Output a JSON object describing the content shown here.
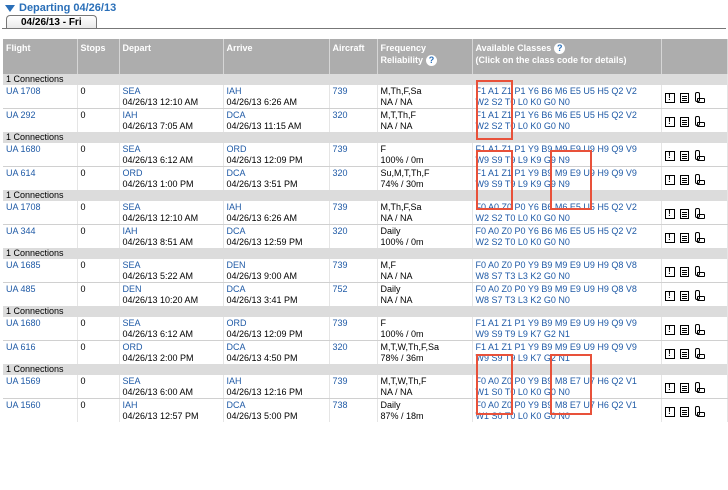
{
  "header": {
    "title": "Departing 04/26/13"
  },
  "tab": {
    "label": "04/26/13 - Fri"
  },
  "columns": {
    "flight": "Flight",
    "stops": "Stops",
    "depart": "Depart",
    "arrive": "Arrive",
    "aircraft": "Aircraft",
    "frequency_line1": "Frequency",
    "frequency_line2": "Reliability",
    "classes_line1": "Available Classes",
    "classes_line2": "(Click on the class code for details)"
  },
  "connection_label": "1 Connections",
  "groups": [
    {
      "legs": [
        {
          "flight": "UA 1708",
          "stops": "0",
          "dep_city": "SEA",
          "dep_time": "04/26/13 12:10 AM",
          "arr_city": "IAH",
          "arr_time": "04/26/13 6:26 AM",
          "aircraft": "739",
          "freq": "M,Th,F,Sa",
          "rel": "NA / NA",
          "cls1": "F1 A1 Z1 P1 Y6 B6 M6 E5 U5 H5 Q2 V2",
          "cls2": "W2 S2 T0 L0 K0 G0 N0"
        },
        {
          "flight": "UA 292",
          "stops": "0",
          "dep_city": "IAH",
          "dep_time": "04/26/13 7:05 AM",
          "arr_city": "DCA",
          "arr_time": "04/26/13 11:15 AM",
          "aircraft": "320",
          "freq": "M,T,Th,F",
          "rel": "NA / NA",
          "cls1": "F1 A1 Z1 P1 Y6 B6 M6 E5 U5 H5 Q2 V2",
          "cls2": "W2 S2 T0 L0 K0 G0 N0"
        }
      ]
    },
    {
      "legs": [
        {
          "flight": "UA 1680",
          "stops": "0",
          "dep_city": "SEA",
          "dep_time": "04/26/13 6:12 AM",
          "arr_city": "ORD",
          "arr_time": "04/26/13 12:09 PM",
          "aircraft": "739",
          "freq": "F",
          "rel": "100% / 0m",
          "cls1": "F1 A1 Z1 P1 Y9 B9 M9 E9 U9 H9 Q9 V9",
          "cls2": "W9 S9 T9 L9 K9 G9 N9"
        },
        {
          "flight": "UA 614",
          "stops": "0",
          "dep_city": "ORD",
          "dep_time": "04/26/13 1:00 PM",
          "arr_city": "DCA",
          "arr_time": "04/26/13 3:51 PM",
          "aircraft": "320",
          "freq": "Su,M,T,Th,F",
          "rel": "74% / 30m",
          "cls1": "F1 A1 Z1 P1 Y9 B9 M9 E9 U9 H9 Q9 V9",
          "cls2": "W9 S9 T9 L9 K9 G9 N9"
        }
      ]
    },
    {
      "legs": [
        {
          "flight": "UA 1708",
          "stops": "0",
          "dep_city": "SEA",
          "dep_time": "04/26/13 12:10 AM",
          "arr_city": "IAH",
          "arr_time": "04/26/13 6:26 AM",
          "aircraft": "739",
          "freq": "M,Th,F,Sa",
          "rel": "NA / NA",
          "cls1": "F0 A0 Z0 P0 Y6 B6 M6 E5 U5 H5 Q2 V2",
          "cls2": "W2 S2 T0 L0 K0 G0 N0"
        },
        {
          "flight": "UA 344",
          "stops": "0",
          "dep_city": "IAH",
          "dep_time": "04/26/13 8:51 AM",
          "arr_city": "DCA",
          "arr_time": "04/26/13 12:59 PM",
          "aircraft": "320",
          "freq": "Daily",
          "rel": "100% / 0m",
          "cls1": "F0 A0 Z0 P0 Y6 B6 M6 E5 U5 H5 Q2 V2",
          "cls2": "W2 S2 T0 L0 K0 G0 N0"
        }
      ]
    },
    {
      "legs": [
        {
          "flight": "UA 1685",
          "stops": "0",
          "dep_city": "SEA",
          "dep_time": "04/26/13 5:22 AM",
          "arr_city": "DEN",
          "arr_time": "04/26/13 9:00 AM",
          "aircraft": "739",
          "freq": "M,F",
          "rel": "NA / NA",
          "cls1": "F0 A0 Z0 P0 Y9 B9 M9 E9 U9 H9 Q8 V8",
          "cls2": "W8 S7 T3 L3 K2 G0 N0"
        },
        {
          "flight": "UA 485",
          "stops": "0",
          "dep_city": "DEN",
          "dep_time": "04/26/13 10:20 AM",
          "arr_city": "DCA",
          "arr_time": "04/26/13 3:41 PM",
          "aircraft": "752",
          "freq": "Daily",
          "rel": "NA / NA",
          "cls1": "F0 A0 Z0 P0 Y9 B9 M9 E9 U9 H9 Q8 V8",
          "cls2": "W8 S7 T3 L3 K2 G0 N0"
        }
      ]
    },
    {
      "legs": [
        {
          "flight": "UA 1680",
          "stops": "0",
          "dep_city": "SEA",
          "dep_time": "04/26/13 6:12 AM",
          "arr_city": "ORD",
          "arr_time": "04/26/13 12:09 PM",
          "aircraft": "739",
          "freq": "F",
          "rel": "100% / 0m",
          "cls1": "F1 A1 Z1 P1 Y9 B9 M9 E9 U9 H9 Q9 V9",
          "cls2": "W9 S9 T9 L9 K7 G2 N1"
        },
        {
          "flight": "UA 616",
          "stops": "0",
          "dep_city": "ORD",
          "dep_time": "04/26/13 2:00 PM",
          "arr_city": "DCA",
          "arr_time": "04/26/13 4:50 PM",
          "aircraft": "320",
          "freq": "M,T,W,Th,F,Sa",
          "rel": "78% / 36m",
          "cls1": "F1 A1 Z1 P1 Y9 B9 M9 E9 U9 H9 Q9 V9",
          "cls2": "W9 S9 T9 L9 K7 G2 N1"
        }
      ]
    },
    {
      "legs": [
        {
          "flight": "UA 1569",
          "stops": "0",
          "dep_city": "SEA",
          "dep_time": "04/26/13 6:00 AM",
          "arr_city": "IAH",
          "arr_time": "04/26/13 12:16 PM",
          "aircraft": "739",
          "freq": "M,T,W,Th,F",
          "rel": "NA / NA",
          "cls1": "F0 A0 Z0 P0 Y9 B9 M8 E7 U7 H6 Q2 V1",
          "cls2": "W1 S0 T0 L0 K0 G0 N0"
        },
        {
          "flight": "UA 1560",
          "stops": "0",
          "dep_city": "IAH",
          "dep_time": "04/26/13 12:57 PM",
          "arr_city": "DCA",
          "arr_time": "04/26/13 5:00 PM",
          "aircraft": "738",
          "freq": "Daily",
          "rel": "87% / 18m",
          "cls1": "F0 A0 Z0 P0 Y9 B9 M8 E7 U7 H6 Q2 V1",
          "cls2": "W1 S0 T0 L0 K0 G0 N0"
        }
      ]
    }
  ],
  "colors": {
    "highlight": "#e8513a",
    "link": "#1f5aa6",
    "header_bg": "#adadad",
    "connection_bg": "#dcdcdc"
  },
  "icons": [
    "warning-icon",
    "document-icon",
    "seat-icon"
  ]
}
